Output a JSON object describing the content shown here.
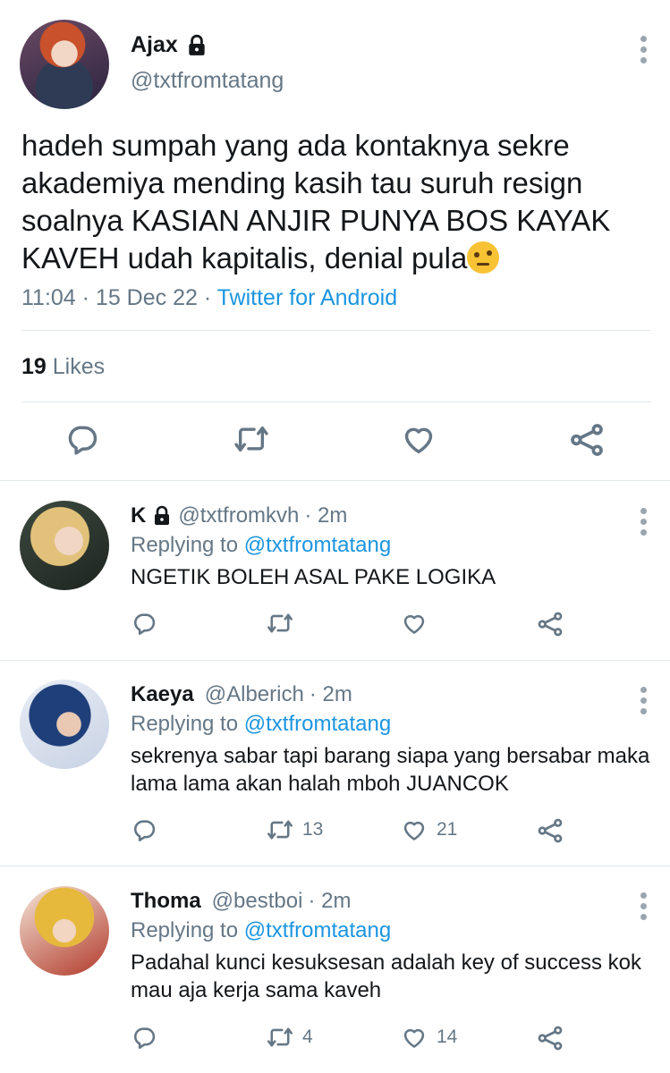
{
  "main_tweet": {
    "display_name": "Ajax",
    "handle": "@txtfromtatang",
    "text": "hadeh sumpah yang ada kontaknya sekre akademiya mending kasih tau suruh resign soalnya KASIAN ANJIR PUNYA BOS KAYAK KAVEH udah kapitalis, denial pula",
    "time": "11:04 · 15 Dec 22 · ",
    "source": "Twitter for Android",
    "likes_count": "19",
    "likes_label": "Likes",
    "emoji": "face-with-raised-eyebrow"
  },
  "replies": [
    {
      "display_name": "K",
      "handle": "@txtfromkvh",
      "time": "· 2m",
      "replying_label": "Replying to",
      "replying_to": "@txtfromtatang",
      "text": "NGETIK BOLEH ASAL PAKE LOGIKA",
      "retweets": "",
      "likes": ""
    },
    {
      "display_name": "Kaeya",
      "handle": "@Alberich",
      "time": "· 2m",
      "replying_label": "Replying to",
      "replying_to": "@txtfromtatang",
      "text": "sekrenya sabar tapi barang siapa yang bersabar maka lama lama akan halah mboh JUANCOK",
      "retweets": "13",
      "likes": "21"
    },
    {
      "display_name": "Thoma",
      "handle": "@bestboi",
      "time": "· 2m",
      "replying_label": "Replying to",
      "replying_to": "@txtfromtatang",
      "text": "Padahal kunci kesuksesan adalah key of success kok mau aja kerja sama kaveh",
      "retweets": "4",
      "likes": "14"
    }
  ],
  "colors": {
    "link": "#1b95e0",
    "muted": "#657786",
    "divider": "#e1e8ed"
  }
}
